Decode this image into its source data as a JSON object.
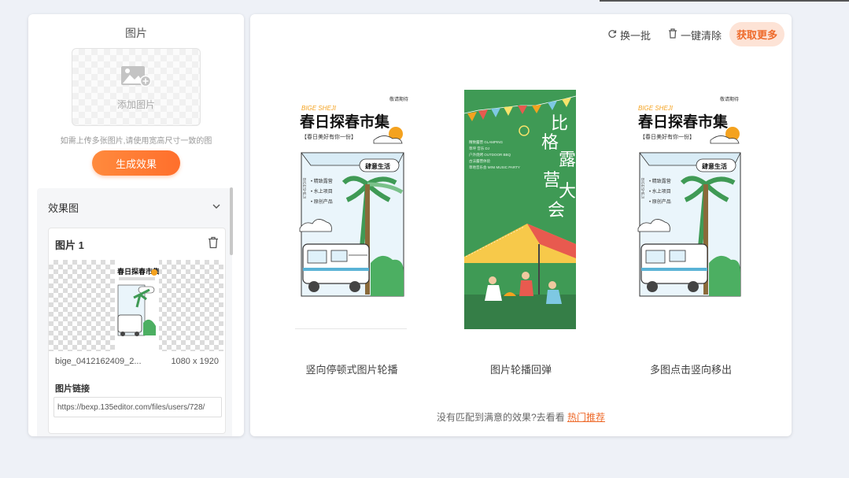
{
  "upload_panel": {
    "title": "图片",
    "add_label": "添加图片",
    "hint": "如需上传多张图片,请使用宽高尺寸一致的图",
    "generate_label": "生成效果"
  },
  "results": {
    "header": "效果图",
    "card": {
      "title": "图片 1",
      "file_name": "bige_0412162409_2...",
      "file_size": "1080 x 1920",
      "link_label": "图片链接",
      "link_value": "https://bexp.135editor.com/files/users/728/"
    }
  },
  "toolbar": {
    "refresh_label": "换一批",
    "clear_label": "一键清除",
    "more_label": "获取更多"
  },
  "poster": {
    "title": "春日探春市集",
    "subtitle": "【春日美好有你一份】",
    "tag": "敬请期待",
    "badge": "肆意生活",
    "items": [
      "精致露营",
      "水上项目",
      "原创产品"
    ]
  },
  "camp_poster": {
    "title_col1": "比格",
    "title_col2": "露营大会",
    "lines": [
      "精致露营 GLAMPING",
      "草坪 音乐 DJ",
      "户外烧烤 OUTDOOR BBQ",
      "古法露营体验",
      "草地音乐会 MINI MUSIC PARTY"
    ]
  },
  "templates": [
    {
      "label": "竖向停顿式图片轮播"
    },
    {
      "label": "图片轮播回弹"
    },
    {
      "label": "多图点击竖向移出"
    }
  ],
  "footer": {
    "text": "没有匹配到满意的效果?去看看",
    "link": "热门推荐"
  },
  "colors": {
    "accent": "#ff7a33",
    "camp_green": "#3f9a55",
    "poster_yellow": "#f4a21f"
  }
}
